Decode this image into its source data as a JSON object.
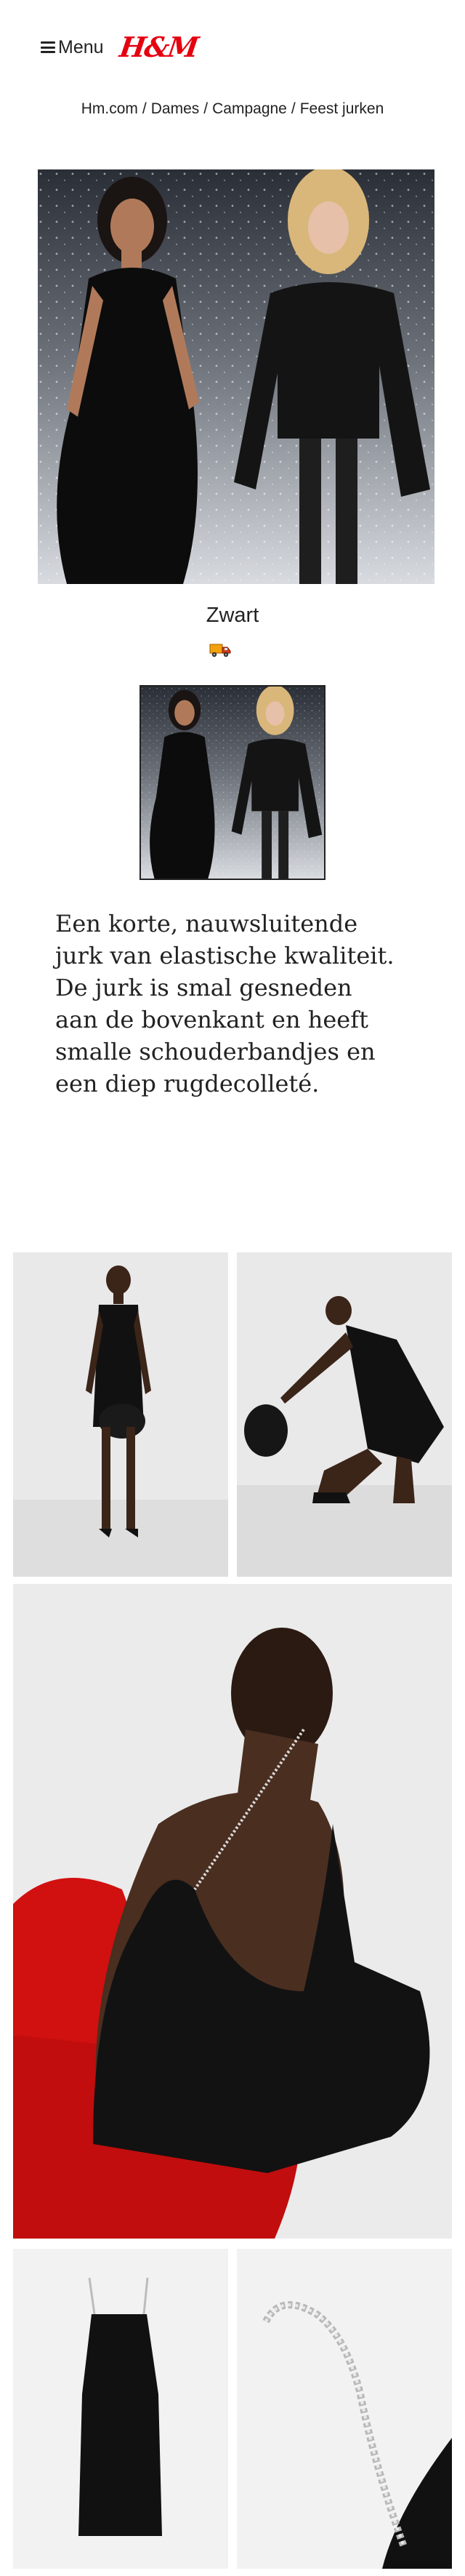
{
  "header": {
    "menu_label": "Menu",
    "logo_text": "H&M",
    "brand_color": "#e50010"
  },
  "breadcrumb": {
    "items": [
      "Hm.com",
      "Dames",
      "Campagne",
      "Feest jurken"
    ],
    "separator": "/"
  },
  "product": {
    "color_name": "Zwart",
    "delivery_icon": "delivery-truck-icon",
    "description": "Een korte, nauwsluitende jurk van elastische kwaliteit. De jurk is smal gesneden aan de bovenkant en heeft smalle schouderbandjes en een diep rugdecolleté."
  },
  "colors": {
    "dress": "#111111",
    "snow_bg": "#c9ccd3",
    "studio_bg": "#e8e8e8",
    "chair_red": "#d11010"
  }
}
